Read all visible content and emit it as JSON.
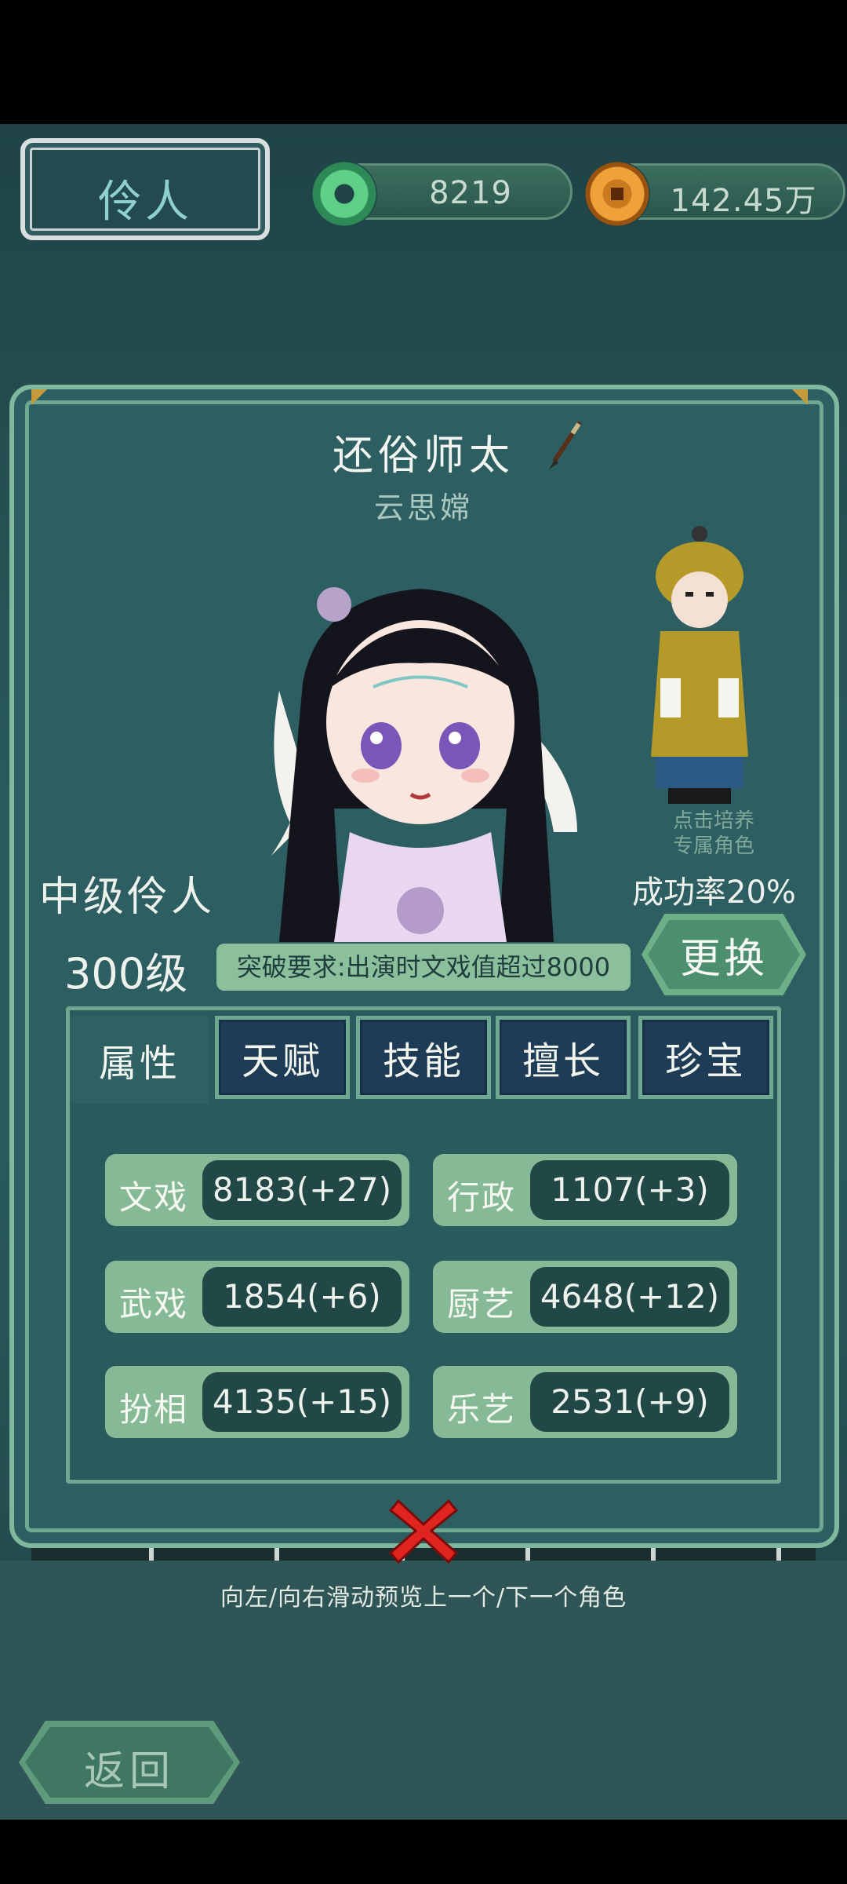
{
  "header": {
    "title": "伶人",
    "jade_amount": "8219",
    "coin_amount": "142.45万"
  },
  "character": {
    "name": "还俗师太",
    "sub_name": "云思嫦",
    "rank_title": "中级伶人",
    "level": "300级",
    "breakthrough_requirement": "突破要求:出演时文戏值超过8000",
    "cultivate_hint_line1": "点击培养",
    "cultivate_hint_line2": "专属角色",
    "success_rate": "成功率20%",
    "change_button": "更换"
  },
  "tabs": [
    "属性",
    "天赋",
    "技能",
    "擅长",
    "珍宝"
  ],
  "stats": [
    {
      "label": "文戏",
      "value": "8183(+27)"
    },
    {
      "label": "行政",
      "value": "1107(+3)"
    },
    {
      "label": "武戏",
      "value": "1854(+6)"
    },
    {
      "label": "厨艺",
      "value": "4648(+12)"
    },
    {
      "label": "扮相",
      "value": "4135(+15)"
    },
    {
      "label": "乐艺",
      "value": "2531(+9)"
    }
  ],
  "swipe_hint": "向左/向右滑动预览上一个/下一个角色",
  "back_button": "返回",
  "icons": {
    "jade": "jade-disc-icon",
    "coin": "copper-coin-icon",
    "brush": "brush-icon",
    "close": "close-icon"
  },
  "colors": {
    "panel": "#2d5e62",
    "panel_border": "#7fb89f",
    "stat_bg": "#86b996",
    "stat_value_bg": "#214746",
    "tab_inactive": "#1f3c57",
    "close_red": "#e0241f"
  }
}
